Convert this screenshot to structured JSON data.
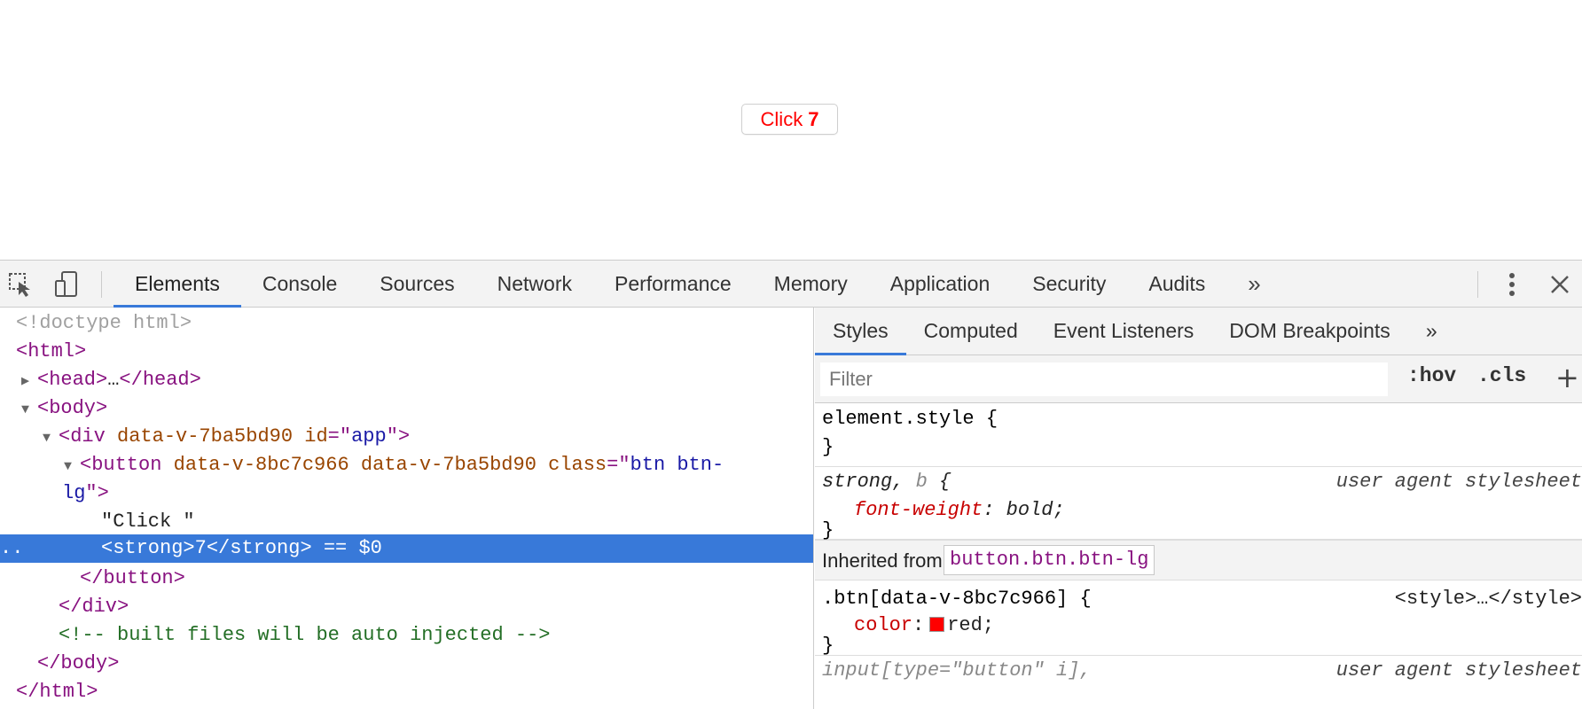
{
  "page": {
    "button": {
      "text": "Click ",
      "count": "7"
    }
  },
  "devtools": {
    "tabs": [
      "Elements",
      "Console",
      "Sources",
      "Network",
      "Performance",
      "Memory",
      "Application",
      "Security",
      "Audits"
    ],
    "more_tabs": "»",
    "active_tab": "Elements",
    "dom": {
      "doctype": "<!doctype html>",
      "html_open": "<html>",
      "head_open": "<head>",
      "ellipsis": "…",
      "head_close": "</head>",
      "body_open": "<body>",
      "div_tag": "div",
      "div_attr1": "data-v-7ba5bd90",
      "div_attr2_name": "id",
      "div_attr2_value": "app",
      "button_tag": "button",
      "button_attr1": "data-v-8bc7c966",
      "button_attr2": "data-v-7ba5bd90",
      "button_attr3_name": "class",
      "button_attr3_value_part1": "btn btn-",
      "button_attr3_value_part2": "lg",
      "text_node": "\"Click \"",
      "strong_open": "<strong>",
      "strong_text": "7",
      "strong_close": "</strong>",
      "selected_marker": "== $0",
      "left_dots": "..",
      "button_close": "</button>",
      "div_close": "</div>",
      "comment": "<!-- built files will be auto injected -->",
      "body_close": "</body>",
      "html_close": "</html>"
    },
    "sidebar": {
      "tabs": [
        "Styles",
        "Computed",
        "Event Listeners",
        "DOM Breakpoints"
      ],
      "more_tabs": "»",
      "active_tab": "Styles",
      "filter_placeholder": "Filter",
      "hov_label": ":hov",
      "cls_label": ".cls",
      "add_label": "+",
      "rules": {
        "element_style_selector": "element.style {",
        "close_brace": "}",
        "strong_selector_a": "strong",
        "strong_selector_sep": ", ",
        "strong_selector_b": "b",
        "open_brace": " {",
        "ua_source": "user agent stylesheet",
        "font_weight_name": "font-weight",
        "font_weight_value": "bold;",
        "inherited_label": "Inherited from",
        "inherited_node": "button.btn.btn-lg",
        "btn_selector": ".btn[data-v-8bc7c966] {",
        "style_source": "<style>…</style>",
        "color_name": "color",
        "color_value": "red;",
        "color_swatch": "#ff0000",
        "cutoff_selector": "input[type=\"button\" i],",
        "cutoff_source": "user agent stylesheet"
      }
    }
  }
}
